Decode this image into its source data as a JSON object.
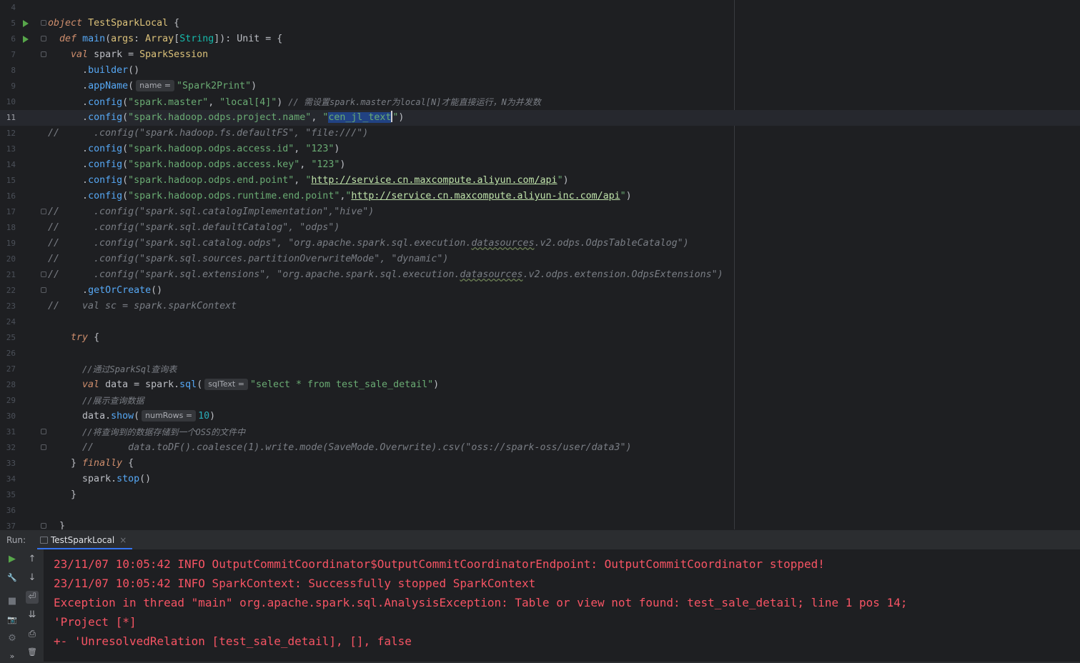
{
  "editor": {
    "lines": [
      {
        "n": "4"
      },
      {
        "n": "5"
      },
      {
        "n": "6"
      },
      {
        "n": "7"
      },
      {
        "n": "8"
      },
      {
        "n": "9"
      },
      {
        "n": "10"
      },
      {
        "n": "11"
      },
      {
        "n": "12"
      },
      {
        "n": "13"
      },
      {
        "n": "14"
      },
      {
        "n": "15"
      },
      {
        "n": "16"
      },
      {
        "n": "17"
      },
      {
        "n": "18"
      },
      {
        "n": "19"
      },
      {
        "n": "20"
      },
      {
        "n": "21"
      },
      {
        "n": "22"
      },
      {
        "n": "23"
      },
      {
        "n": "24"
      },
      {
        "n": "25"
      },
      {
        "n": "26"
      },
      {
        "n": "27"
      },
      {
        "n": "28"
      },
      {
        "n": "29"
      },
      {
        "n": "30"
      },
      {
        "n": "31"
      },
      {
        "n": "32"
      },
      {
        "n": "33"
      },
      {
        "n": "34"
      },
      {
        "n": "35"
      },
      {
        "n": "36"
      },
      {
        "n": "37"
      }
    ],
    "code": {
      "l5": {
        "kw": "object",
        "cls": "TestSparkLocal",
        "rest": " {"
      },
      "l6": {
        "kw": "def",
        "fn": "main",
        "open": "(",
        "param": "args",
        "colon": ": ",
        "type1": "Array",
        "lb": "[",
        "type2": "String",
        "rest": "]): Unit = {"
      },
      "l7": {
        "kw": "val",
        "name": " spark = ",
        "cls": "SparkSession"
      },
      "l8": {
        "dot": ".",
        "fn": "builder",
        "rest": "()"
      },
      "l9": {
        "dot": ".",
        "fn": "appName",
        "open": "(",
        "hint": "name =",
        "str": "\"Spark2Print\"",
        "rest": ")"
      },
      "l10": {
        "dot": ".",
        "fn": "config",
        "open": "(",
        "s1": "\"spark.master\"",
        "comma": ", ",
        "s2": "\"local[4]\"",
        "close": ") ",
        "cmt": "// 需设置spark.master为local[N]才能直接运行，N为并发数"
      },
      "l11": {
        "dot": ".",
        "fn": "config",
        "open": "(",
        "s1": "\"spark.hadoop.odps.project.name\"",
        "comma": ", ",
        "q1": "\"",
        "sel": "cen_jl_text",
        "q2": "\"",
        "rest": ")"
      },
      "l12": {
        "cmt": "//      .config(\"spark.hadoop.fs.defaultFS\", \"file:///\")"
      },
      "l13": {
        "dot": ".",
        "fn": "config",
        "open": "(",
        "s1": "\"spark.hadoop.odps.access.id\"",
        "comma": ", ",
        "s2": "\"123\"",
        "rest": ")"
      },
      "l14": {
        "dot": ".",
        "fn": "config",
        "open": "(",
        "s1": "\"spark.hadoop.odps.access.key\"",
        "comma": ", ",
        "s2": "\"123\"",
        "rest": ")"
      },
      "l15": {
        "dot": ".",
        "fn": "config",
        "open": "(",
        "s1": "\"spark.hadoop.odps.end.point\"",
        "comma": ", ",
        "q1": "\"",
        "url": "http://service.cn.maxcompute.aliyun.com/api",
        "q2": "\"",
        "rest": ")"
      },
      "l16": {
        "dot": ".",
        "fn": "config",
        "open": "(",
        "s1": "\"spark.hadoop.odps.runtime.end.point\"",
        "comma": ",",
        "q1": "\"",
        "url": "http://service.cn.maxcompute.aliyun-inc.com/api",
        "q2": "\"",
        "rest": ")"
      },
      "l17": {
        "cmt": "//      .config(\"spark.sql.catalogImplementation\",\"hive\")"
      },
      "l18": {
        "cmt": "//      .config(\"spark.sql.defaultCatalog\", \"odps\")"
      },
      "l19": {
        "c1": "//      .config(\"spark.sql.catalog.odps\", \"org.apache.spark.sql.execution.",
        "sq": "datasources",
        "c2": ".v2.odps.OdpsTableCatalog\")"
      },
      "l20": {
        "cmt": "//      .config(\"spark.sql.sources.partitionOverwriteMode\", \"dynamic\")"
      },
      "l21": {
        "c1": "//      .config(\"spark.sql.extensions\", \"org.apache.spark.sql.execution.",
        "sq": "datasources",
        "c2": ".v2.odps.extension.OdpsExtensions\")"
      },
      "l22": {
        "dot": ".",
        "fn": "getOrCreate",
        "rest": "()"
      },
      "l23": {
        "cmt": "//    val sc = spark.sparkContext"
      },
      "l25": {
        "kw": "try",
        "rest": " {"
      },
      "l27": {
        "cmt": "//通过SparkSql查询表"
      },
      "l28": {
        "kw": "val",
        "name": " data = spark.",
        "fn": "sql",
        "open": "(",
        "hint": "sqlText =",
        "str": "\"select * from test_sale_detail\"",
        "rest": ")"
      },
      "l29": {
        "cmt": "//展示查询数据"
      },
      "l30": {
        "name": "data.",
        "fn": "show",
        "open": "(",
        "hint": "numRows =",
        "num": "10",
        "rest": ")"
      },
      "l31": {
        "cmt": "//将查询到的数据存储到一个OSS的文件中"
      },
      "l32": {
        "cmt": "//      data.toDF().coalesce(1).write.mode(SaveMode.Overwrite).csv(\"oss://spark-oss/user/data3\")"
      },
      "l33": {
        "pre": "} ",
        "kw": "finally",
        "rest": " {"
      },
      "l34": {
        "name": "spark.",
        "fn": "stop",
        "rest": "()"
      },
      "l35": {
        "rest": "}"
      },
      "l37": {
        "rest": "}"
      }
    }
  },
  "run_panel": {
    "label": "Run:",
    "tab_label": "TestSparkLocal",
    "close_glyph": "×",
    "console_lines": [
      "23/11/07 10:05:42 INFO OutputCommitCoordinator$OutputCommitCoordinatorEndpoint: OutputCommitCoordinator stopped!",
      "23/11/07 10:05:42 INFO SparkContext: Successfully stopped SparkContext",
      "Exception in thread \"main\" org.apache.spark.sql.AnalysisException: Table or view not found: test_sale_detail; line 1 pos 14;",
      "'Project [*]",
      "+- 'UnresolvedRelation [test_sale_detail], [], false"
    ],
    "tools": {
      "rerun": "▶",
      "up": "↑",
      "wrench": "🔧",
      "down": "↓",
      "stop": "■",
      "wrap": "⏎",
      "camera": "📷",
      "scroll_end": "⇊",
      "settings": "⚙",
      "print": "⎙",
      "trash": "🗑",
      "more": "»"
    }
  },
  "colors": {
    "editor_bg": "#1e1f22",
    "panel_bg": "#2b2d30",
    "error_text": "#f75464",
    "run_green": "#57a64a",
    "tab_underline": "#3574f0"
  }
}
